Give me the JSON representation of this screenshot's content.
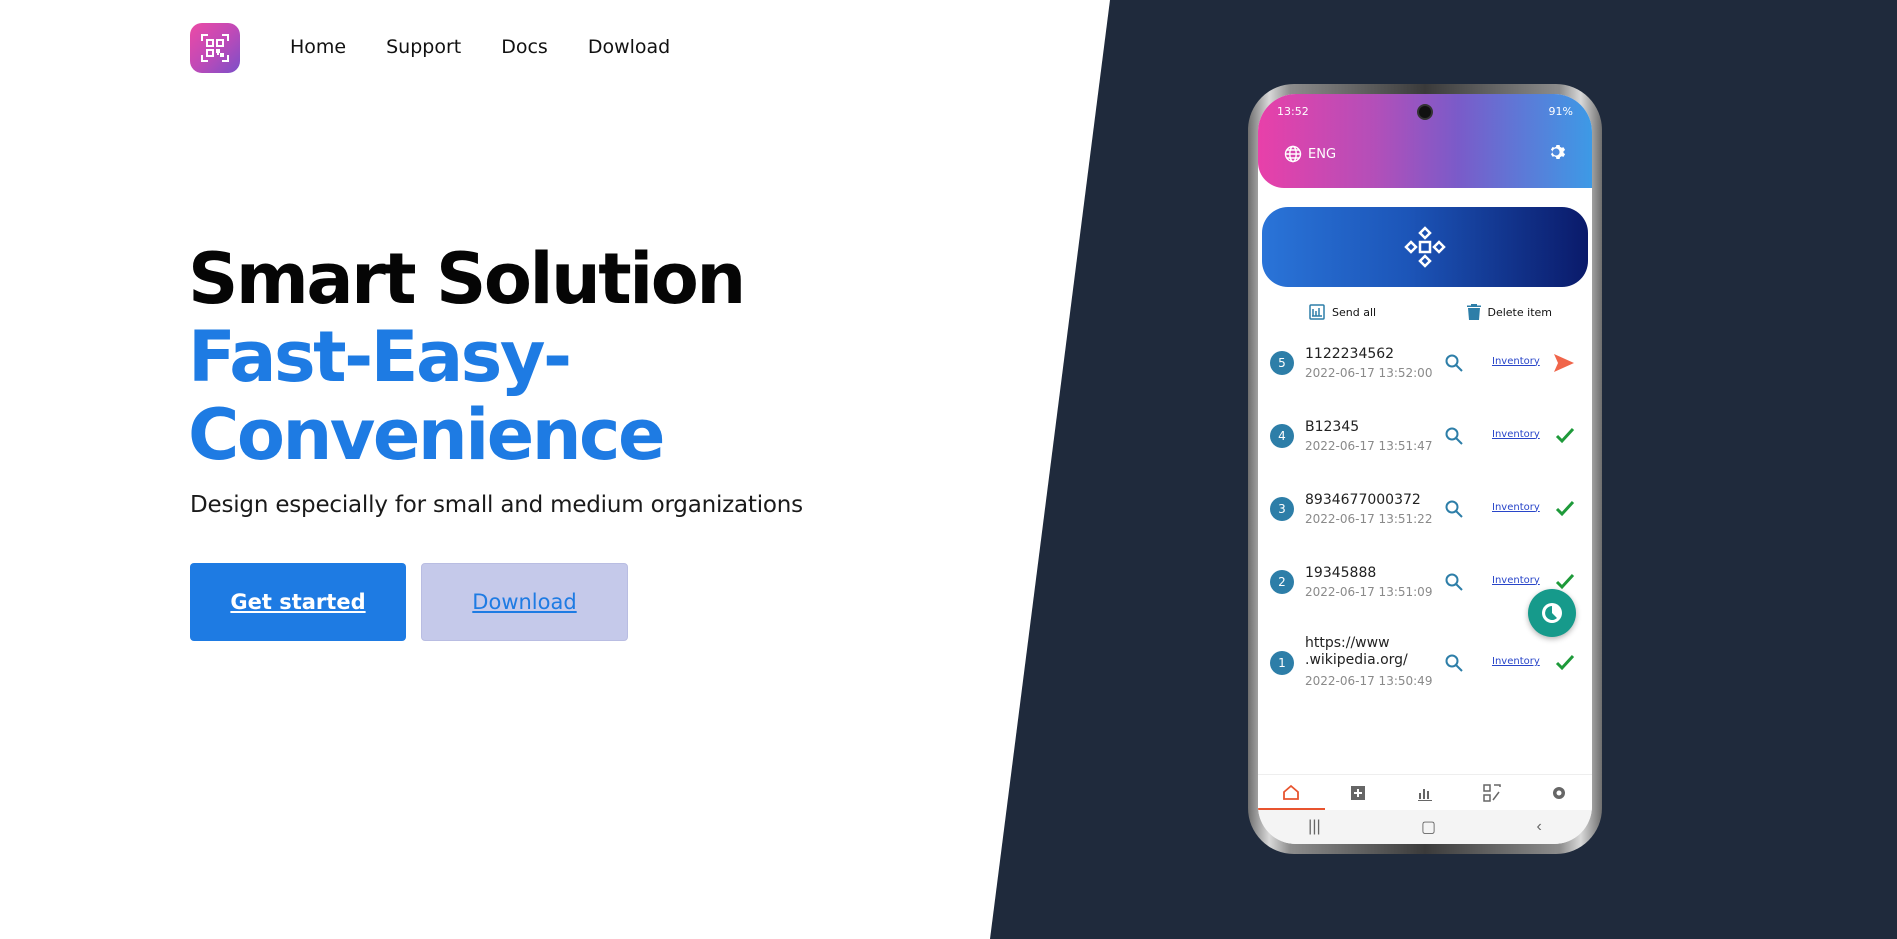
{
  "nav": {
    "logo_icon": "qr-code-icon",
    "items": [
      {
        "label": "Home"
      },
      {
        "label": "Support"
      },
      {
        "label": "Docs"
      },
      {
        "label": "Dowload"
      }
    ]
  },
  "hero": {
    "title_line1": "Smart Solution",
    "title_line2": "Fast-Easy-",
    "title_line3": "Convenience",
    "subtitle": "Design especially for small and medium organizations",
    "primary_button": "Get started",
    "secondary_button": "Download"
  },
  "colors": {
    "accent": "#1e7be3",
    "dark_panel": "#1f2a3c",
    "secondary_button_bg": "#c5c9ea"
  },
  "phone": {
    "status_time": "13:52",
    "status_right": "91%",
    "language": "ENG",
    "send_all": "Send all",
    "delete_item": "Delete item",
    "items": [
      {
        "num": "5",
        "code": "1122234562",
        "date": "2022-06-17 13:52:00",
        "link": "Inventory",
        "status": "send-icon"
      },
      {
        "num": "4",
        "code": "B12345",
        "date": "2022-06-17 13:51:47",
        "link": "Inventory",
        "status": "check-icon"
      },
      {
        "num": "3",
        "code": "8934677000372",
        "date": "2022-06-17 13:51:22",
        "link": "Inventory",
        "status": "check-icon"
      },
      {
        "num": "2",
        "code": "19345888",
        "date": "2022-06-17 13:51:09",
        "link": "Inventory",
        "status": "check-icon"
      },
      {
        "num": "1",
        "code": "https://www\n.wikipedia.org/",
        "date": "2022-06-17 13:50:49",
        "link": "Inventory",
        "status": "check-icon"
      }
    ],
    "tabs": [
      "home-icon",
      "add-box-icon",
      "chart-icon",
      "qr-edit-icon",
      "settings-icon"
    ]
  }
}
